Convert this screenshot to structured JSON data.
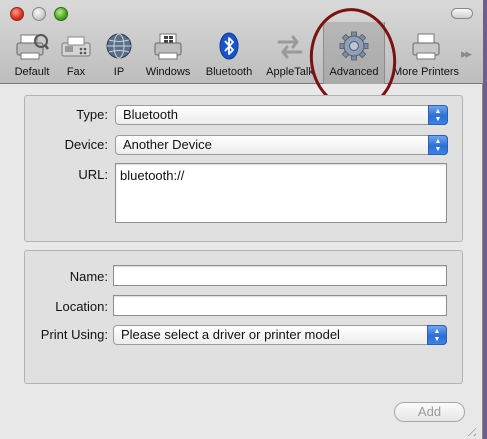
{
  "toolbar": {
    "items": [
      {
        "label": "Default",
        "icon": "default-printer-icon"
      },
      {
        "label": "Fax",
        "icon": "fax-icon"
      },
      {
        "label": "IP",
        "icon": "ip-globe-icon"
      },
      {
        "label": "Windows",
        "icon": "windows-printer-icon"
      },
      {
        "label": "Bluetooth",
        "icon": "bluetooth-icon"
      },
      {
        "label": "AppleTalk",
        "icon": "appletalk-arrows-icon"
      },
      {
        "label": "Advanced",
        "icon": "gear-icon",
        "selected": true
      },
      {
        "label": "More Printers",
        "icon": "printer-icon"
      }
    ],
    "overflow_icon": "chevron-double-right-icon"
  },
  "connection": {
    "type_label": "Type:",
    "type_value": "Bluetooth",
    "device_label": "Device:",
    "device_value": "Another Device",
    "url_label": "URL:",
    "url_value": "bluetooth://"
  },
  "printer": {
    "name_label": "Name:",
    "name_value": "",
    "location_label": "Location:",
    "location_value": "",
    "print_using_label": "Print Using:",
    "print_using_value": "Please select a driver or printer model"
  },
  "footer": {
    "add_label": "Add"
  },
  "colors": {
    "annotation_circle": "#7a1212",
    "popup_arrow_blue": "#2b6fd6",
    "desktop": "#6d5f87"
  }
}
